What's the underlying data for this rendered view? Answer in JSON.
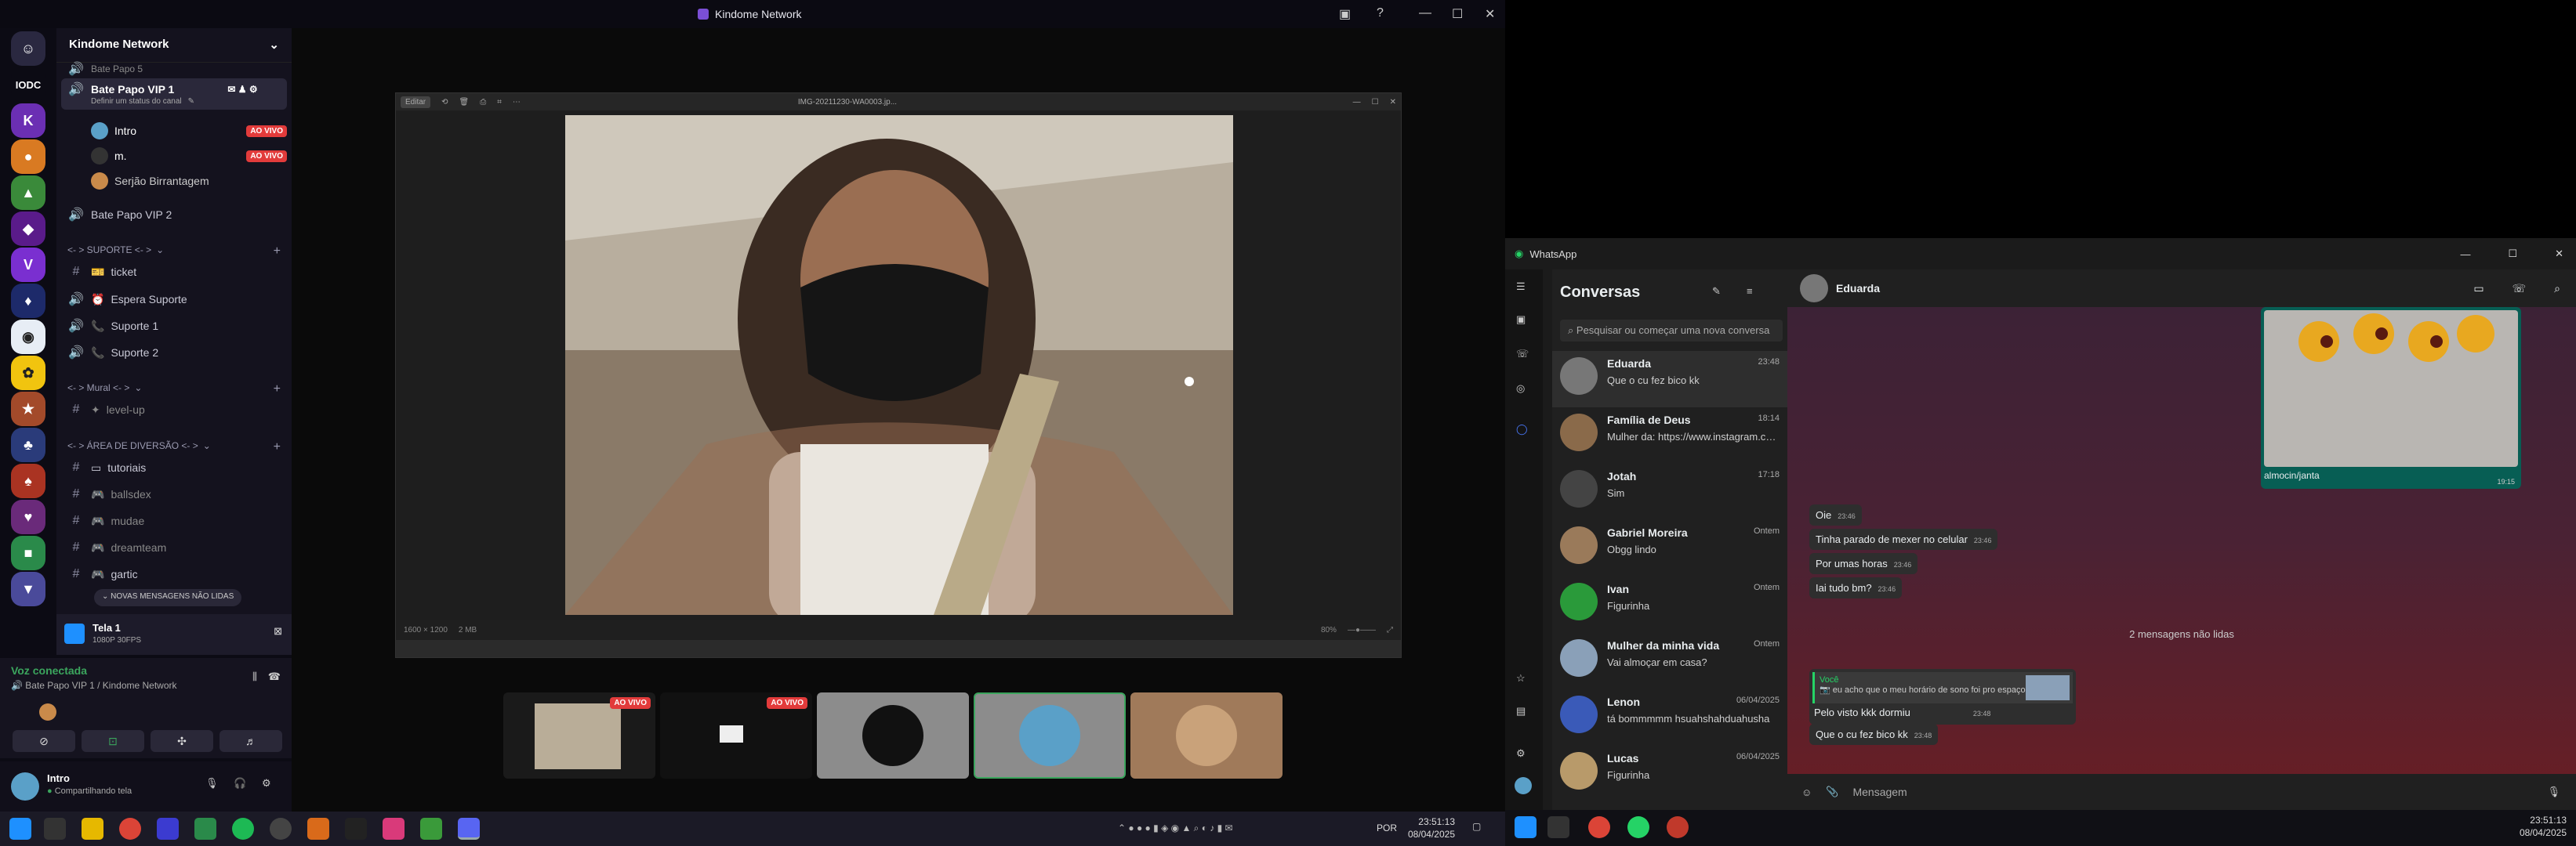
{
  "discord_window": {
    "title": "Kindome Network"
  },
  "server": {
    "name": "Kindome Network"
  },
  "rail_icons": [
    "IODC"
  ],
  "channels": {
    "top_cut": "Bate Papo 5",
    "vip1": {
      "name": "Bate Papo VIP 1",
      "status": "Definir um status do canal"
    },
    "members": [
      {
        "name": "Intro",
        "badge": "AO VIVO"
      },
      {
        "name": "m.",
        "badge": "AO VIVO"
      },
      {
        "name": "Serjão Birrantagem"
      }
    ],
    "vip2": "Bate Papo VIP 2",
    "cat_suporte": "<- > SUPORTE <- >",
    "suporte": [
      "ticket",
      "Espera Suporte",
      "Suporte 1",
      "Suporte 2"
    ],
    "cat_mural": "<- > Mural <- >",
    "mural": [
      "level-up"
    ],
    "cat_area": "<- > ÁREA DE DIVERSÃO <- >",
    "area": [
      "tutoriais",
      "ballsdex",
      "mudae",
      "dreamteam",
      "gartic"
    ],
    "new_msgs": "NOVAS MENSAGENS NÃO LIDAS"
  },
  "stream": {
    "title": "Tela 1",
    "quality": "1080P 30FPS"
  },
  "voice": {
    "status": "Voz conectada",
    "location": "Bate Papo VIP 1 / Kindome Network"
  },
  "user": {
    "name": "Intro",
    "status": "Compartilhando tela"
  },
  "photo_viewer": {
    "filename": "IMG-20211230-WA0003.jp...",
    "edit": "Editar",
    "dims": "1600 × 1200",
    "size": "2 MB",
    "zoom": "80%"
  },
  "tiles": [
    {
      "badge": "AO VIVO"
    },
    {
      "badge": "AO VIVO"
    }
  ],
  "taskbar_left": {
    "lang": "POR",
    "time": "23:51:13",
    "date": "08/04/2025"
  },
  "whatsapp": {
    "title": "WhatsApp",
    "heading": "Conversas",
    "search_placeholder": "Pesquisar ou começar uma nova conversa",
    "conversations": [
      {
        "name": "Eduarda",
        "time": "23:48",
        "msg": "Que o cu fez bico kk"
      },
      {
        "name": "Família de Deus",
        "time": "18:14",
        "msg": "Mulher da: https://www.instagram.com/ree..."
      },
      {
        "name": "Jotah",
        "time": "17:18",
        "msg": "Sim"
      },
      {
        "name": "Gabriel Moreira",
        "time": "Ontem",
        "msg": "Obgg lindo"
      },
      {
        "name": "Ivan",
        "time": "Ontem",
        "msg": "Figurinha"
      },
      {
        "name": "Mulher da minha vida",
        "time": "Ontem",
        "msg": "Vai almoçar em casa?"
      },
      {
        "name": "Lenon",
        "time": "06/04/2025",
        "msg": "tá bommmmm hsuahshahduahusha"
      },
      {
        "name": "Lucas",
        "time": "06/04/2025",
        "msg": "Figurinha"
      }
    ],
    "chat": {
      "contact": "Eduarda",
      "image_caption": "almocin/janta",
      "image_time": "19:15",
      "messages": [
        {
          "text": "Oie",
          "time": "23:46"
        },
        {
          "text": "Tinha parado de mexer no celular",
          "time": "23:46"
        },
        {
          "text": "Por umas horas",
          "time": "23:46"
        },
        {
          "text": "Iai tudo bm?",
          "time": "23:46"
        }
      ],
      "unread": "2 mensagens não lidas",
      "quote_author": "Você",
      "quote_text": "eu acho que o meu horário de sono foi pro espaço",
      "replies": [
        {
          "text": "Pelo visto kkk dormiu",
          "time": "23:48"
        },
        {
          "text": "Que o cu fez bico kk",
          "time": "23:48"
        }
      ],
      "input_placeholder": "Mensagem"
    }
  },
  "taskbar_right": {
    "time": "23:51:13",
    "date": "08/04/2025"
  }
}
